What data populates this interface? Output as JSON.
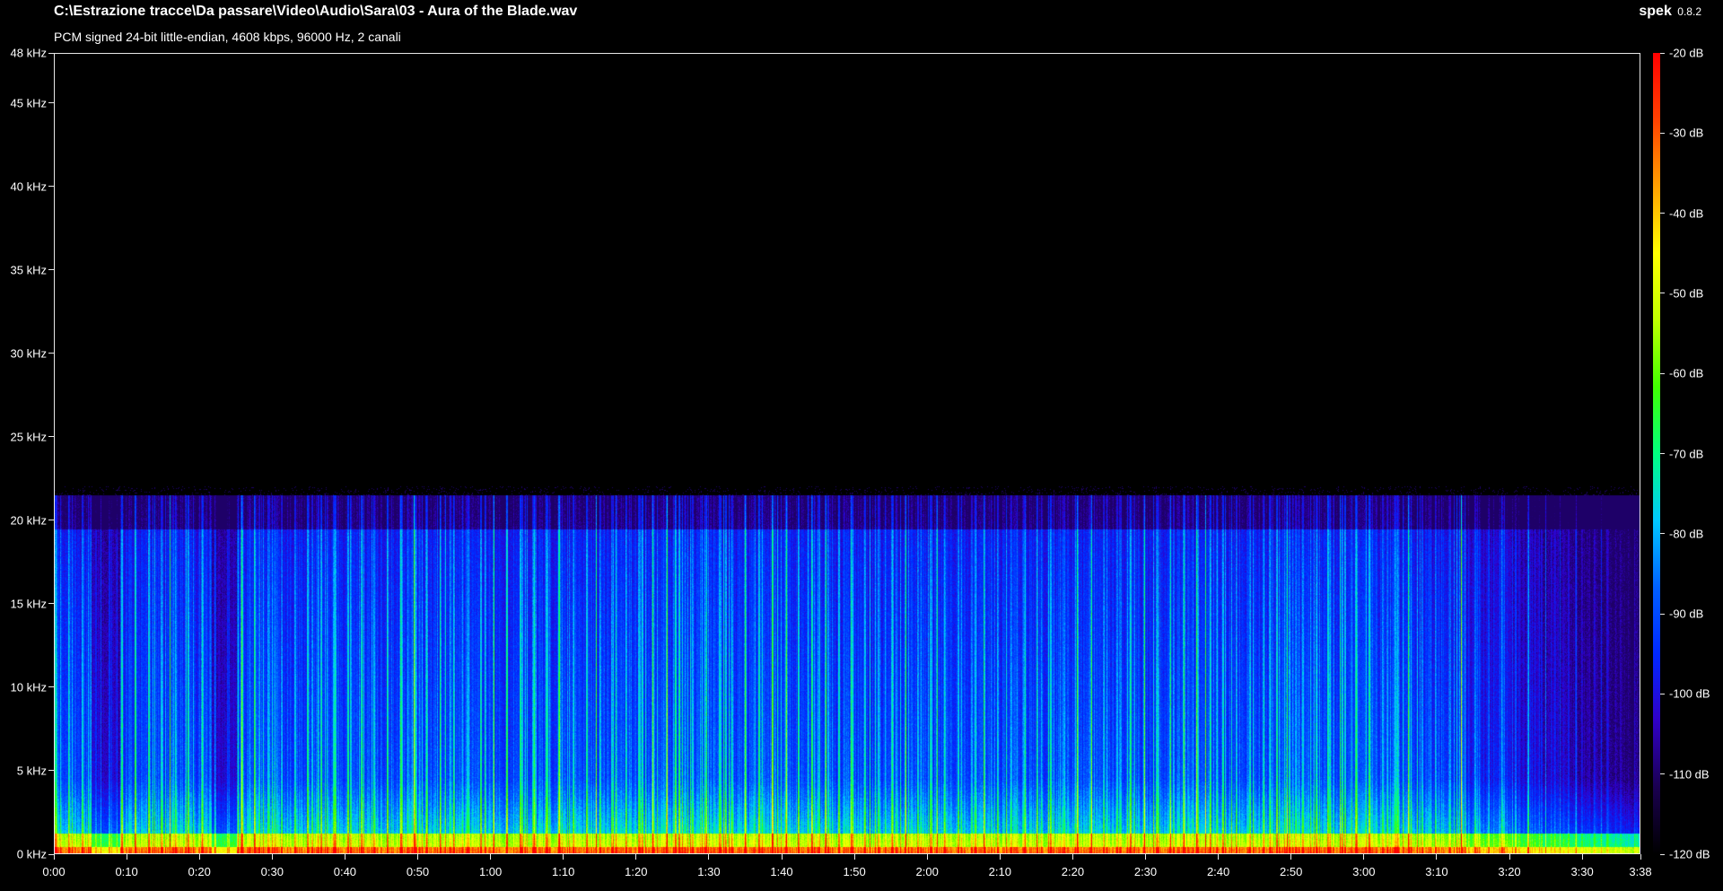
{
  "header": {
    "file_path": "C:\\Estrazione tracce\\Da passare\\Video\\Audio\\Sara\\03 - Aura of the Blade.wav",
    "file_info": "PCM signed 24-bit little-endian, 4608 kbps, 96000 Hz, 2 canali"
  },
  "brand": {
    "name": "spek",
    "version": "0.8.2"
  },
  "frequency_axis": {
    "unit": "kHz",
    "max_khz": 48,
    "ticks": [
      "0 kHz",
      "5 kHz",
      "10 kHz",
      "15 kHz",
      "20 kHz",
      "25 kHz",
      "30 kHz",
      "35 kHz",
      "40 kHz",
      "45 kHz",
      "48 kHz"
    ],
    "tick_values_khz": [
      0,
      5,
      10,
      15,
      20,
      25,
      30,
      35,
      40,
      45,
      48
    ]
  },
  "time_axis": {
    "duration_seconds": 218,
    "ticks": [
      "0:00",
      "0:10",
      "0:20",
      "0:30",
      "0:40",
      "0:50",
      "1:00",
      "1:10",
      "1:20",
      "1:30",
      "1:40",
      "1:50",
      "2:00",
      "2:10",
      "2:20",
      "2:30",
      "2:40",
      "2:50",
      "3:00",
      "3:10",
      "3:20",
      "3:30",
      "3:38"
    ],
    "tick_values_seconds": [
      0,
      10,
      20,
      30,
      40,
      50,
      60,
      70,
      80,
      90,
      100,
      110,
      120,
      130,
      140,
      150,
      160,
      170,
      180,
      190,
      200,
      210,
      218
    ]
  },
  "db_scale": {
    "min_db": -120,
    "max_db": -20,
    "ticks": [
      "-20 dB",
      "-30 dB",
      "-40 dB",
      "-50 dB",
      "-60 dB",
      "-70 dB",
      "-80 dB",
      "-90 dB",
      "-100 dB",
      "-110 dB",
      "-120 dB"
    ],
    "tick_values_db": [
      -20,
      -30,
      -40,
      -50,
      -60,
      -70,
      -80,
      -90,
      -100,
      -110,
      -120
    ],
    "colors": [
      "#000000",
      "#1a0050",
      "#3000c8",
      "#0028ff",
      "#0060ff",
      "#00c8ff",
      "#00ff80",
      "#40ff00",
      "#c0ff00",
      "#ffff00",
      "#ffa000",
      "#ff4000",
      "#ff0000"
    ]
  },
  "spectrogram": {
    "content_cutoff_khz": 21.5
  }
}
